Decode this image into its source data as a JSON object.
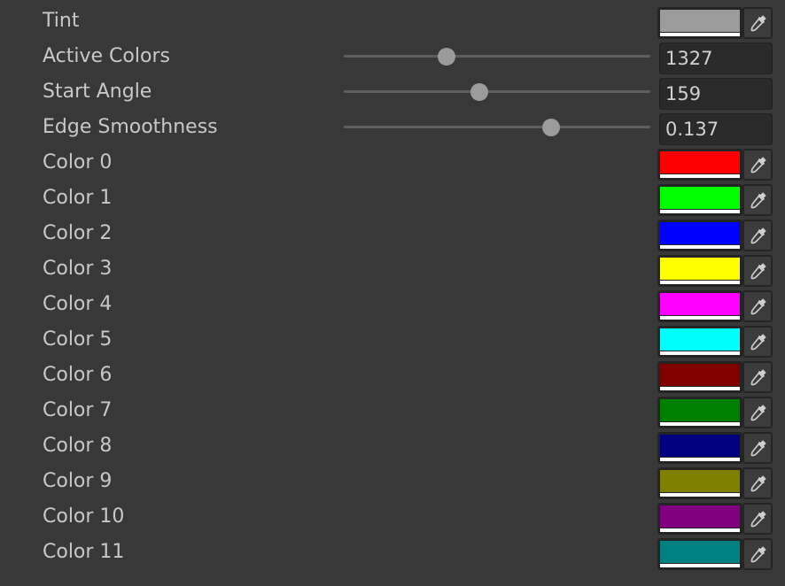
{
  "tint": {
    "label": "Tint",
    "color": "#9b9b9b"
  },
  "sliders": [
    {
      "label": "Active Colors",
      "value": "1327",
      "fraction": 0.335
    },
    {
      "label": "Start Angle",
      "value": "159",
      "fraction": 0.443
    },
    {
      "label": "Edge Smoothness",
      "value": "0.137",
      "fraction": 0.676
    }
  ],
  "colors": [
    {
      "label": "Color 0",
      "color": "#ff0000"
    },
    {
      "label": "Color 1",
      "color": "#00ff00"
    },
    {
      "label": "Color 2",
      "color": "#0000ff"
    },
    {
      "label": "Color 3",
      "color": "#ffff00"
    },
    {
      "label": "Color 4",
      "color": "#ff00ff"
    },
    {
      "label": "Color 5",
      "color": "#00ffff"
    },
    {
      "label": "Color 6",
      "color": "#800000"
    },
    {
      "label": "Color 7",
      "color": "#008000"
    },
    {
      "label": "Color 8",
      "color": "#000080"
    },
    {
      "label": "Color 9",
      "color": "#808000"
    },
    {
      "label": "Color 10",
      "color": "#800080"
    },
    {
      "label": "Color 11",
      "color": "#008080"
    }
  ],
  "icons": {
    "picker": "eyedropper-icon"
  }
}
